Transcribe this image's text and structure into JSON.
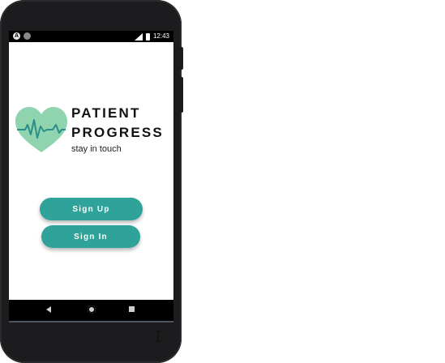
{
  "status_bar": {
    "left_icons": [
      "a-icon",
      "circle-icon"
    ],
    "left_icon_glyph": "A",
    "time": "12:43"
  },
  "brand": {
    "line1": "PATIENT",
    "line2": "PROGRESS",
    "tagline": "stay in touch"
  },
  "buttons": {
    "signup_label": "Sign Up",
    "signin_label": "Sign In"
  },
  "nav": {
    "icons": [
      "back-icon",
      "home-icon",
      "recents-icon"
    ]
  },
  "colors": {
    "accent": "#2fa29a",
    "heart": "#8fd4ae",
    "pulse": "#2b8e88"
  }
}
